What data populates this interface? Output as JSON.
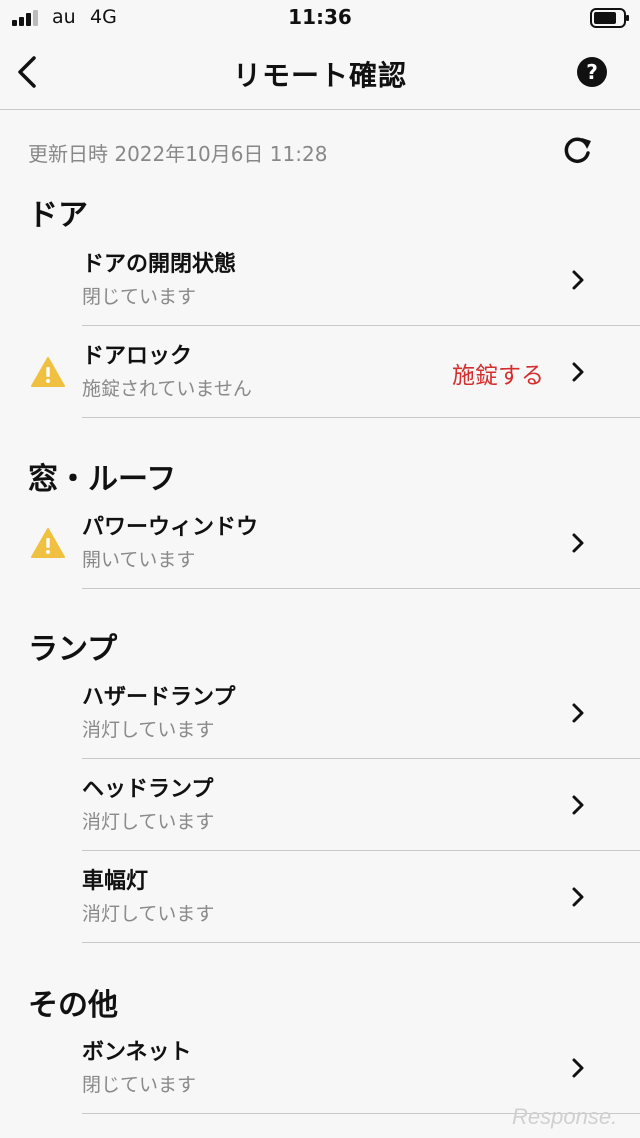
{
  "status_bar": {
    "carrier": "au",
    "network": "4G",
    "time": "11:36"
  },
  "nav": {
    "title": "リモート確認"
  },
  "update": {
    "label": "更新日時 2022年10月6日 11:28"
  },
  "sections": {
    "door": {
      "title": "ドア",
      "items": [
        {
          "title": "ドアの開閉状態",
          "status": "閉じています"
        },
        {
          "title": "ドアロック",
          "status": "施錠されていません",
          "action": "施錠する",
          "warning": true
        }
      ]
    },
    "window": {
      "title": "窓・ルーフ",
      "items": [
        {
          "title": "パワーウィンドウ",
          "status": "開いています",
          "warning": true
        }
      ]
    },
    "lamp": {
      "title": "ランプ",
      "items": [
        {
          "title": "ハザードランプ",
          "status": "消灯しています"
        },
        {
          "title": "ヘッドランプ",
          "status": "消灯しています"
        },
        {
          "title": "車幅灯",
          "status": "消灯しています"
        }
      ]
    },
    "other": {
      "title": "その他",
      "items": [
        {
          "title": "ボンネット",
          "status": "閉じています"
        }
      ]
    }
  },
  "watermark": "Response.",
  "colors": {
    "accent_red": "#d32f2f",
    "warning_yellow": "#f0c040",
    "divider": "#c9c9c9",
    "muted_text": "#8a8a8a"
  },
  "icons": [
    "signal-icon",
    "battery-icon",
    "back-arrow-icon",
    "help-icon",
    "refresh-icon",
    "warning-icon",
    "chevron-right-icon"
  ]
}
